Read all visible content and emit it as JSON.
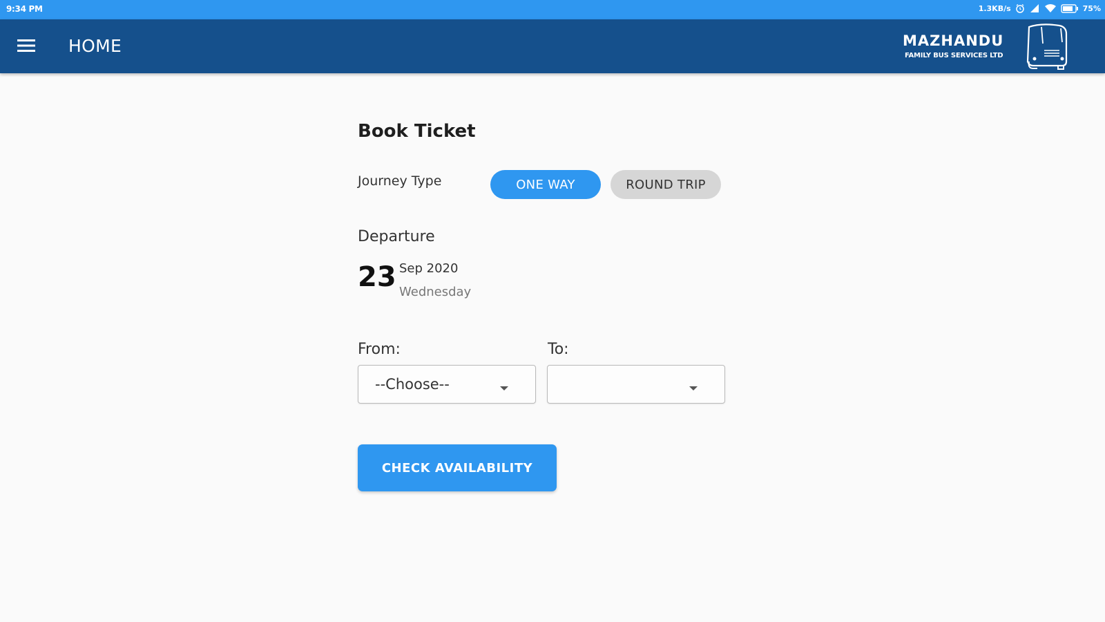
{
  "status_bar": {
    "time": "9:34 PM",
    "net_speed": "1.3KB/s",
    "battery_percent": "75%",
    "icons": [
      "alarm-icon",
      "signal-icon",
      "wifi-icon",
      "battery-icon"
    ]
  },
  "app_bar": {
    "title": "HOME",
    "menu_icon": "hamburger-menu-icon",
    "brand_name": "MAZHANDU",
    "brand_subtitle": "FAMILY BUS SERVICES LTD",
    "brand_icon": "bus-icon"
  },
  "booking": {
    "title": "Book Ticket",
    "journey_type_label": "Journey Type",
    "journey_options": [
      {
        "label": "ONE WAY",
        "selected": true
      },
      {
        "label": "ROUND TRIP",
        "selected": false
      }
    ],
    "departure_label": "Departure",
    "date": {
      "day": "23",
      "month_year": "Sep 2020",
      "weekday": "Wednesday"
    },
    "from_label": "From:",
    "from_value": "--Choose--",
    "to_label": "To:",
    "to_value": "",
    "check_button": "CHECK AVAILABILITY"
  },
  "colors": {
    "status_bar": "#2f97f0",
    "app_bar": "#15508c",
    "accent": "#2f97f0",
    "chip_inactive": "#d6d6d6",
    "background": "#fafafa"
  }
}
